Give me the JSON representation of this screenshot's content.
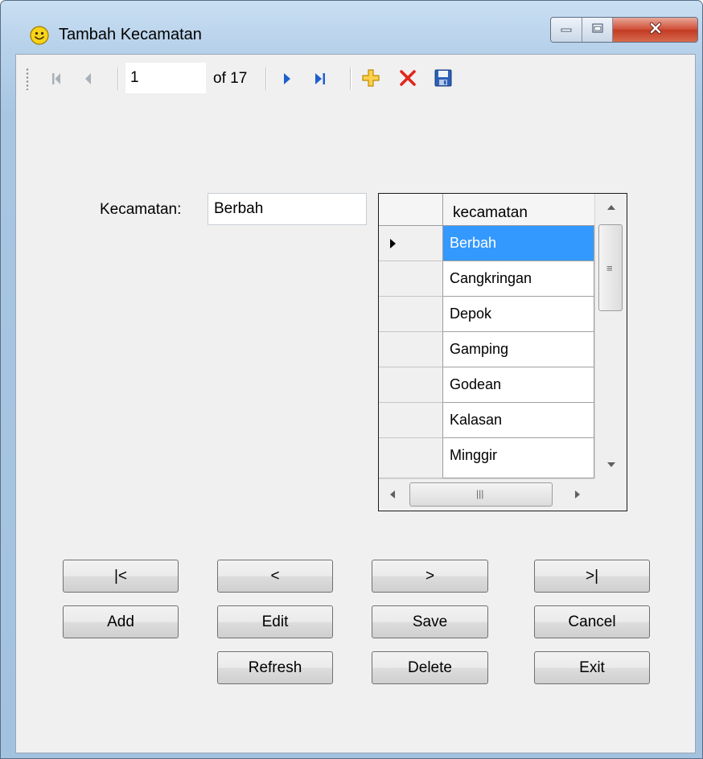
{
  "window": {
    "title": "Tambah Kecamatan",
    "controls": [
      "minimize",
      "maximize",
      "close"
    ]
  },
  "toolbar": {
    "position_value": "1",
    "count_label": "of 17",
    "icons": [
      "move-first-icon",
      "move-previous-icon",
      "move-next-icon",
      "move-last-icon",
      "add-new-icon",
      "delete-icon",
      "save-icon"
    ]
  },
  "form": {
    "kecamatan_label": "Kecamatan:",
    "kecamatan_value": "Berbah"
  },
  "grid": {
    "column_header": "kecamatan",
    "rows": [
      "Berbah",
      "Cangkringan",
      "Depok",
      "Gamping",
      "Godean",
      "Kalasan",
      "Minggir"
    ],
    "selected_index": 0
  },
  "buttons": {
    "first": "|<",
    "prev": "<",
    "next": ">",
    "last": ">|",
    "add": "Add",
    "edit": "Edit",
    "save": "Save",
    "cancel": "Cancel",
    "refresh": "Refresh",
    "delete": "Delete",
    "exit": "Exit"
  },
  "colors": {
    "selection": "#3399ff",
    "title_bar": "#b7d1ea",
    "client_bg": "#f0f0f0"
  }
}
